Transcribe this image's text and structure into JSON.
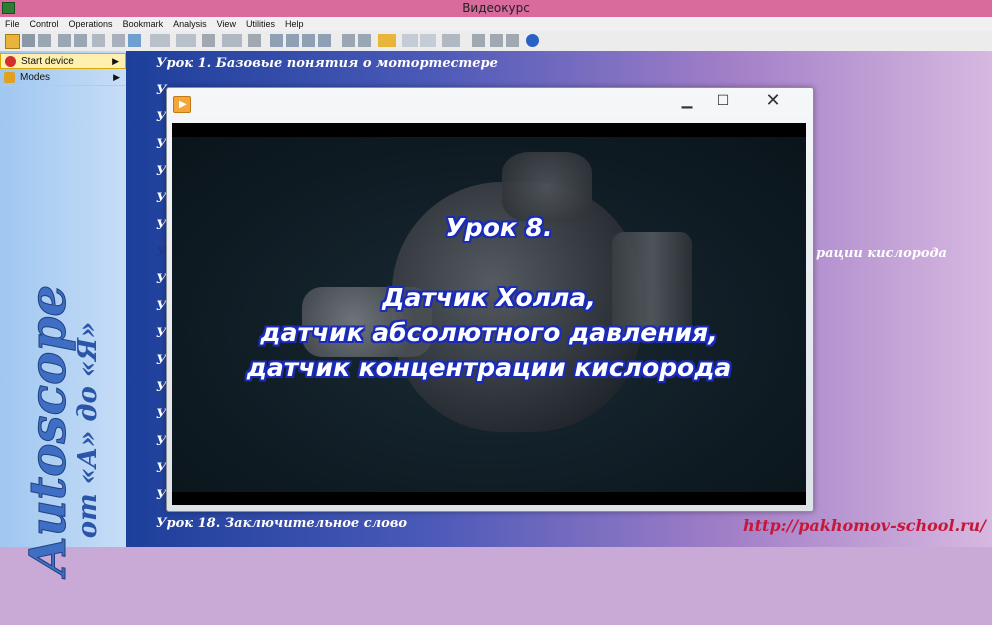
{
  "window": {
    "title": "Видеокурс"
  },
  "menu": [
    "File",
    "Control",
    "Operations",
    "Bookmark",
    "Analysis",
    "View",
    "Utilities",
    "Help"
  ],
  "left_panel": {
    "items": [
      {
        "label": "Start device",
        "icon": "power-icon",
        "active": true
      },
      {
        "label": "Modes",
        "icon": "modes-icon",
        "active": false
      }
    ],
    "brand": "Autoscope",
    "brand_sub": "от «А» до «Я»"
  },
  "lessons": {
    "first": "Урок 1. Базовые понятия о мотортестере",
    "last": "Урок 18. Заключительное слово",
    "row_prefix": "У",
    "partial_text": "рации кислорода"
  },
  "player": {
    "icon": "play-icon",
    "controls": [
      "minimize-icon",
      "maximize-icon",
      "close-icon"
    ],
    "video_text": {
      "line1": "Урок 8.",
      "line2": "Датчик Холла,",
      "line3": "датчик абсолютного давления,",
      "line4": "датчик концентрации кислорода"
    }
  },
  "footer": {
    "url": "http://pakhomov-school.ru/"
  },
  "colors": {
    "titlebar": "#d86a9c",
    "url": "#c6173a",
    "brand": "#3e6fc4"
  }
}
